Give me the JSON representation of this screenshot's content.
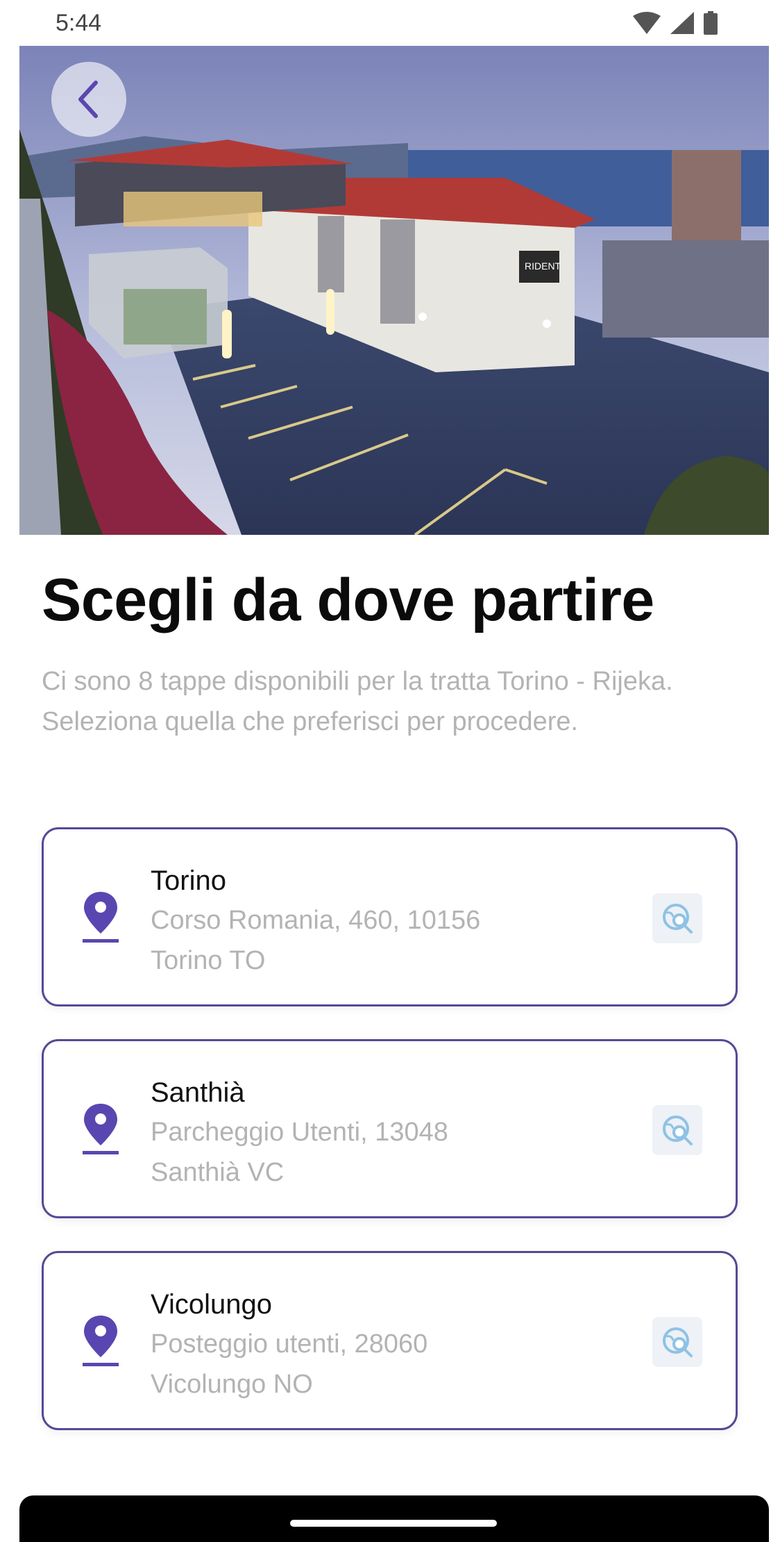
{
  "status_bar": {
    "time": "5:44",
    "icons": [
      "wifi-icon",
      "signal-icon",
      "battery-icon"
    ]
  },
  "header": {
    "back_icon": "chevron-left-icon"
  },
  "hero_image": {
    "sign_text": "RIDENT"
  },
  "page": {
    "title": "Scegli da dove partire",
    "subtitle": "Ci sono 8 tappe disponibili per la tratta Torino - Rijeka. Seleziona quella che preferisci per procedere."
  },
  "stops": [
    {
      "name": "Torino",
      "address": "Corso Romania, 460, 10156 Torino TO"
    },
    {
      "name": "Santhià",
      "address": "Parcheggio Utenti, 13048 Santhià VC"
    },
    {
      "name": "Vicolungo",
      "address": "Posteggio utenti, 28060 Vicolungo NO"
    }
  ],
  "colors": {
    "accent": "#5a46b0",
    "card_border": "#544a96",
    "map_icon": "#8ec2e6",
    "muted_text": "#b3b3b3"
  }
}
